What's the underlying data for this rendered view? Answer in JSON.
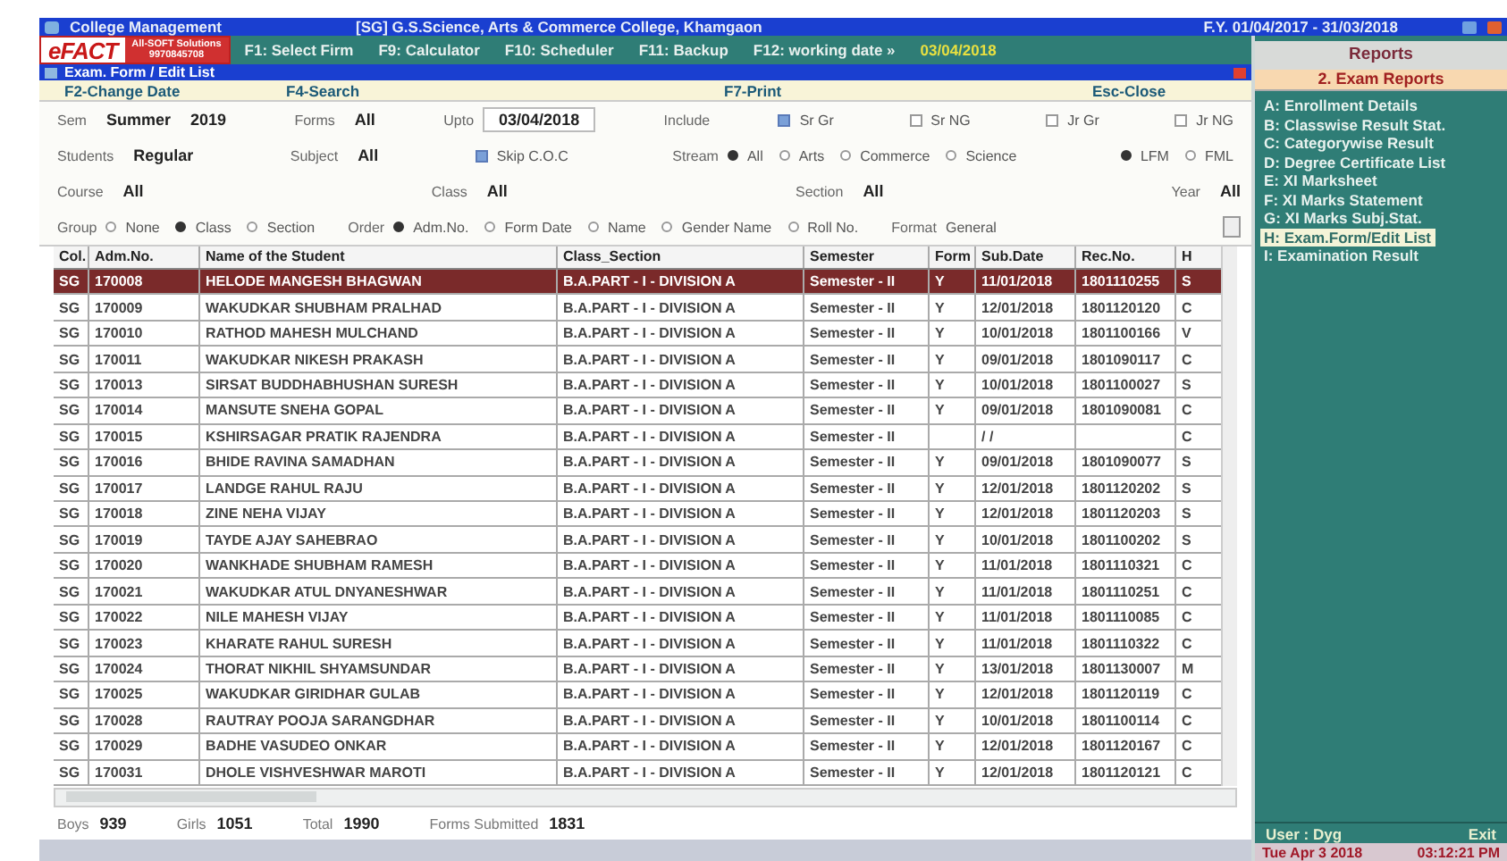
{
  "title_bar": {
    "app": "College Management",
    "college": "[SG] G.S.Science, Arts & Commerce College, Khamgaon",
    "year": "F.Y. 01/04/2017 - 31/03/2018"
  },
  "toolbar": {
    "logo": "eFACT",
    "vendor": "All-SOFT Solutions",
    "phone": "9970845708",
    "items": [
      "F1: Select Firm",
      "F9: Calculator",
      "F10: Scheduler",
      "F11: Backup",
      "F12: working date »"
    ],
    "working_date": "03/04/2018"
  },
  "window": {
    "title": "Exam. Form / Edit List"
  },
  "function_keys": [
    "F2-Change Date",
    "F4-Search",
    "F7-Print",
    "Esc-Close"
  ],
  "filter_rows": [
    [
      {
        "kind": "field",
        "label": "Sem",
        "values": [
          "Summer",
          "2019"
        ]
      },
      {
        "kind": "field",
        "label": "Forms",
        "values": [
          "All"
        ]
      },
      {
        "kind": "input",
        "label": "Upto",
        "value": "03/04/2018"
      },
      {
        "kind": "text",
        "label": "Include"
      },
      {
        "kind": "check",
        "label": "Sr Gr",
        "checked": true
      },
      {
        "kind": "check",
        "label": "Sr NG",
        "checked": false
      },
      {
        "kind": "check",
        "label": "Jr Gr",
        "checked": false
      },
      {
        "kind": "check",
        "label": "Jr NG",
        "checked": false
      }
    ],
    [
      {
        "kind": "field",
        "label": "Students",
        "values": [
          "Regular"
        ]
      },
      {
        "kind": "field",
        "label": "Subject",
        "values": [
          "All"
        ]
      },
      {
        "kind": "check",
        "label": "Skip C.O.C",
        "checked": true
      },
      {
        "kind": "group",
        "label": "Stream",
        "options": [
          {
            "label": "All",
            "selected": true
          },
          {
            "label": "Arts",
            "selected": false
          },
          {
            "label": "Commerce",
            "selected": false
          },
          {
            "label": "Science",
            "selected": false
          }
        ]
      },
      {
        "kind": "group",
        "options": [
          {
            "label": "LFM",
            "selected": true
          },
          {
            "label": "FML",
            "selected": false
          }
        ]
      }
    ],
    [
      {
        "kind": "field",
        "label": "Course",
        "values": [
          "All"
        ]
      },
      {
        "kind": "field",
        "label": "Class",
        "values": [
          "All"
        ]
      },
      {
        "kind": "field",
        "label": "Section",
        "values": [
          "All"
        ]
      },
      {
        "kind": "field",
        "label": "Year",
        "values": [
          "All"
        ]
      }
    ],
    [
      {
        "kind": "group",
        "label": "Group",
        "options": [
          {
            "label": "None",
            "selected": false
          },
          {
            "label": "Class",
            "selected": true
          },
          {
            "label": "Section",
            "selected": false
          }
        ]
      },
      {
        "kind": "group",
        "label": "Order",
        "options": [
          {
            "label": "Adm.No.",
            "selected": true
          },
          {
            "label": "Form Date",
            "selected": false
          },
          {
            "label": "Name",
            "selected": false
          },
          {
            "label": "Gender Name",
            "selected": false
          },
          {
            "label": "Roll No.",
            "selected": false
          }
        ]
      },
      {
        "kind": "select",
        "label": "Format",
        "value": "General"
      }
    ]
  ],
  "table": {
    "columns": [
      "Col.",
      "Adm.No.",
      "Name of the Student",
      "Class_Section",
      "Semester",
      "Form",
      "Sub.Date",
      "Rec.No.",
      "H"
    ],
    "rows": [
      {
        "selected": true,
        "cells": [
          "SG",
          "170008",
          "HELODE MANGESH BHAGWAN",
          "B.A.PART - I - DIVISION A",
          "Semester - II",
          "Y",
          "11/01/2018",
          "1801110255",
          "S"
        ]
      },
      {
        "selected": false,
        "cells": [
          "SG",
          "170009",
          "WAKUDKAR SHUBHAM PRALHAD",
          "B.A.PART - I - DIVISION A",
          "Semester - II",
          "Y",
          "12/01/2018",
          "1801120120",
          "C"
        ]
      },
      {
        "selected": false,
        "cells": [
          "SG",
          "170010",
          "RATHOD MAHESH MULCHAND",
          "B.A.PART - I - DIVISION A",
          "Semester - II",
          "Y",
          "10/01/2018",
          "1801100166",
          "V"
        ]
      },
      {
        "selected": false,
        "cells": [
          "SG",
          "170011",
          "WAKUDKAR NIKESH PRAKASH",
          "B.A.PART - I - DIVISION A",
          "Semester - II",
          "Y",
          "09/01/2018",
          "1801090117",
          "C"
        ]
      },
      {
        "selected": false,
        "cells": [
          "SG",
          "170013",
          "SIRSAT BUDDHABHUSHAN SURESH",
          "B.A.PART - I - DIVISION A",
          "Semester - II",
          "Y",
          "10/01/2018",
          "1801100027",
          "S"
        ]
      },
      {
        "selected": false,
        "cells": [
          "SG",
          "170014",
          "MANSUTE SNEHA GOPAL",
          "B.A.PART - I - DIVISION A",
          "Semester - II",
          "Y",
          "09/01/2018",
          "1801090081",
          "C"
        ]
      },
      {
        "selected": false,
        "cells": [
          "SG",
          "170015",
          "KSHIRSAGAR PRATIK RAJENDRA",
          "B.A.PART - I - DIVISION A",
          "Semester - II",
          "",
          "/ /",
          "",
          "C"
        ]
      },
      {
        "selected": false,
        "cells": [
          "SG",
          "170016",
          "BHIDE RAVINA SAMADHAN",
          "B.A.PART - I - DIVISION A",
          "Semester - II",
          "Y",
          "09/01/2018",
          "1801090077",
          "S"
        ]
      },
      {
        "selected": false,
        "cells": [
          "SG",
          "170017",
          "LANDGE RAHUL RAJU",
          "B.A.PART - I - DIVISION A",
          "Semester - II",
          "Y",
          "12/01/2018",
          "1801120202",
          "S"
        ]
      },
      {
        "selected": false,
        "cells": [
          "SG",
          "170018",
          "ZINE NEHA VIJAY",
          "B.A.PART - I - DIVISION A",
          "Semester - II",
          "Y",
          "12/01/2018",
          "1801120203",
          "S"
        ]
      },
      {
        "selected": false,
        "cells": [
          "SG",
          "170019",
          "TAYDE AJAY SAHEBRAO",
          "B.A.PART - I - DIVISION A",
          "Semester - II",
          "Y",
          "10/01/2018",
          "1801100202",
          "S"
        ]
      },
      {
        "selected": false,
        "cells": [
          "SG",
          "170020",
          "WANKHADE SHUBHAM RAMESH",
          "B.A.PART - I - DIVISION A",
          "Semester - II",
          "Y",
          "11/01/2018",
          "1801110321",
          "C"
        ]
      },
      {
        "selected": false,
        "cells": [
          "SG",
          "170021",
          "WAKUDKAR ATUL DNYANESHWAR",
          "B.A.PART - I - DIVISION A",
          "Semester - II",
          "Y",
          "11/01/2018",
          "1801110251",
          "C"
        ]
      },
      {
        "selected": false,
        "cells": [
          "SG",
          "170022",
          "NILE MAHESH VIJAY",
          "B.A.PART - I - DIVISION A",
          "Semester - II",
          "Y",
          "11/01/2018",
          "1801110085",
          "C"
        ]
      },
      {
        "selected": false,
        "cells": [
          "SG",
          "170023",
          "KHARATE RAHUL SURESH",
          "B.A.PART - I - DIVISION A",
          "Semester - II",
          "Y",
          "11/01/2018",
          "1801110322",
          "C"
        ]
      },
      {
        "selected": false,
        "cells": [
          "SG",
          "170024",
          "THORAT NIKHIL SHYAMSUNDAR",
          "B.A.PART - I - DIVISION A",
          "Semester - II",
          "Y",
          "13/01/2018",
          "1801130007",
          "M"
        ]
      },
      {
        "selected": false,
        "cells": [
          "SG",
          "170025",
          "WAKUDKAR GIRIDHAR GULAB",
          "B.A.PART - I - DIVISION A",
          "Semester - II",
          "Y",
          "12/01/2018",
          "1801120119",
          "C"
        ]
      },
      {
        "selected": false,
        "cells": [
          "SG",
          "170028",
          "RAUTRAY POOJA SARANGDHAR",
          "B.A.PART - I - DIVISION A",
          "Semester - II",
          "Y",
          "10/01/2018",
          "1801100114",
          "C"
        ]
      },
      {
        "selected": false,
        "cells": [
          "SG",
          "170029",
          "BADHE VASUDEO ONKAR",
          "B.A.PART - I - DIVISION A",
          "Semester - II",
          "Y",
          "12/01/2018",
          "1801120167",
          "C"
        ]
      },
      {
        "selected": false,
        "cells": [
          "SG",
          "170031",
          "DHOLE VISHVESHWAR MAROTI",
          "B.A.PART - I - DIVISION A",
          "Semester - II",
          "Y",
          "12/01/2018",
          "1801120121",
          "C"
        ]
      }
    ]
  },
  "totals": [
    {
      "label": "Boys",
      "value": "939"
    },
    {
      "label": "Girls",
      "value": "1051"
    },
    {
      "label": "Total",
      "value": "1990"
    },
    {
      "label": "Forms Submitted",
      "value": "1831"
    }
  ],
  "reports": {
    "title": "Reports",
    "section": "2. Exam Reports",
    "items": [
      {
        "label": "A: Enrollment Details",
        "selected": false
      },
      {
        "label": "B: Classwise Result Stat.",
        "selected": false
      },
      {
        "label": "C: Categorywise Result",
        "selected": false
      },
      {
        "label": "D: Degree Certificate List",
        "selected": false
      },
      {
        "label": "E: XI Marksheet",
        "selected": false
      },
      {
        "label": "F: XI Marks Statement",
        "selected": false
      },
      {
        "label": "G: XI Marks Subj.Stat.",
        "selected": false
      },
      {
        "label": "H: Exam.Form/Edit List",
        "selected": true
      },
      {
        "label": "I: Examination Result",
        "selected": false
      }
    ]
  },
  "status": {
    "user": "User : Dyg",
    "exit": "Exit",
    "date": "Tue Apr 3 2018",
    "time": "03:12:21 PM"
  }
}
